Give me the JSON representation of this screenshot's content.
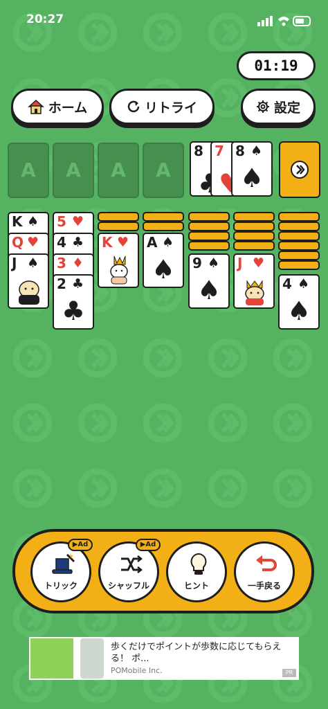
{
  "status_bar": {
    "time": "20:27"
  },
  "timer": "01:19",
  "top_buttons": {
    "home": "ホーム",
    "retry": "リトライ",
    "settings": "設定"
  },
  "foundations": [
    "A",
    "A",
    "A",
    "A"
  ],
  "waste": [
    {
      "rank": "8",
      "suit": "♣",
      "color": "black"
    },
    {
      "rank": "7",
      "suit": "♥",
      "color": "red"
    },
    {
      "rank": "8",
      "suit": "♠",
      "color": "black"
    }
  ],
  "tableau": {
    "col1": [
      {
        "rank": "K",
        "suit": "♠"
      },
      {
        "rank": "Q",
        "suit": "♥"
      },
      {
        "rank": "J",
        "suit": "♠"
      }
    ],
    "col2": [
      {
        "rank": "5",
        "suit": "♥"
      },
      {
        "rank": "4",
        "suit": "♣"
      },
      {
        "rank": "3",
        "suit": "♦"
      },
      {
        "rank": "2",
        "suit": "♣"
      }
    ],
    "col3": [
      {
        "rank": "K",
        "suit": "♥"
      }
    ],
    "col4": [
      {
        "rank": "A",
        "suit": "♠"
      }
    ],
    "col5": [
      {
        "rank": "9",
        "suit": "♠"
      }
    ],
    "col6": [
      {
        "rank": "J",
        "suit": "♥"
      }
    ],
    "col7": [
      {
        "rank": "4",
        "suit": "♠"
      }
    ]
  },
  "toolbar": {
    "trick": "トリック",
    "shuffle": "シャッフル",
    "hint": "ヒント",
    "undo": "一手戻る",
    "ad_badge": "▶Ad"
  },
  "ad_banner": {
    "text": "歩くだけでポイントが歩数に応じてもらえる！ ポ...",
    "advertiser": "POMobile Inc.",
    "pr": "PR"
  },
  "colors": {
    "felt": "#54b261",
    "accent": "#f2b016",
    "red_suit": "#e2443a"
  }
}
